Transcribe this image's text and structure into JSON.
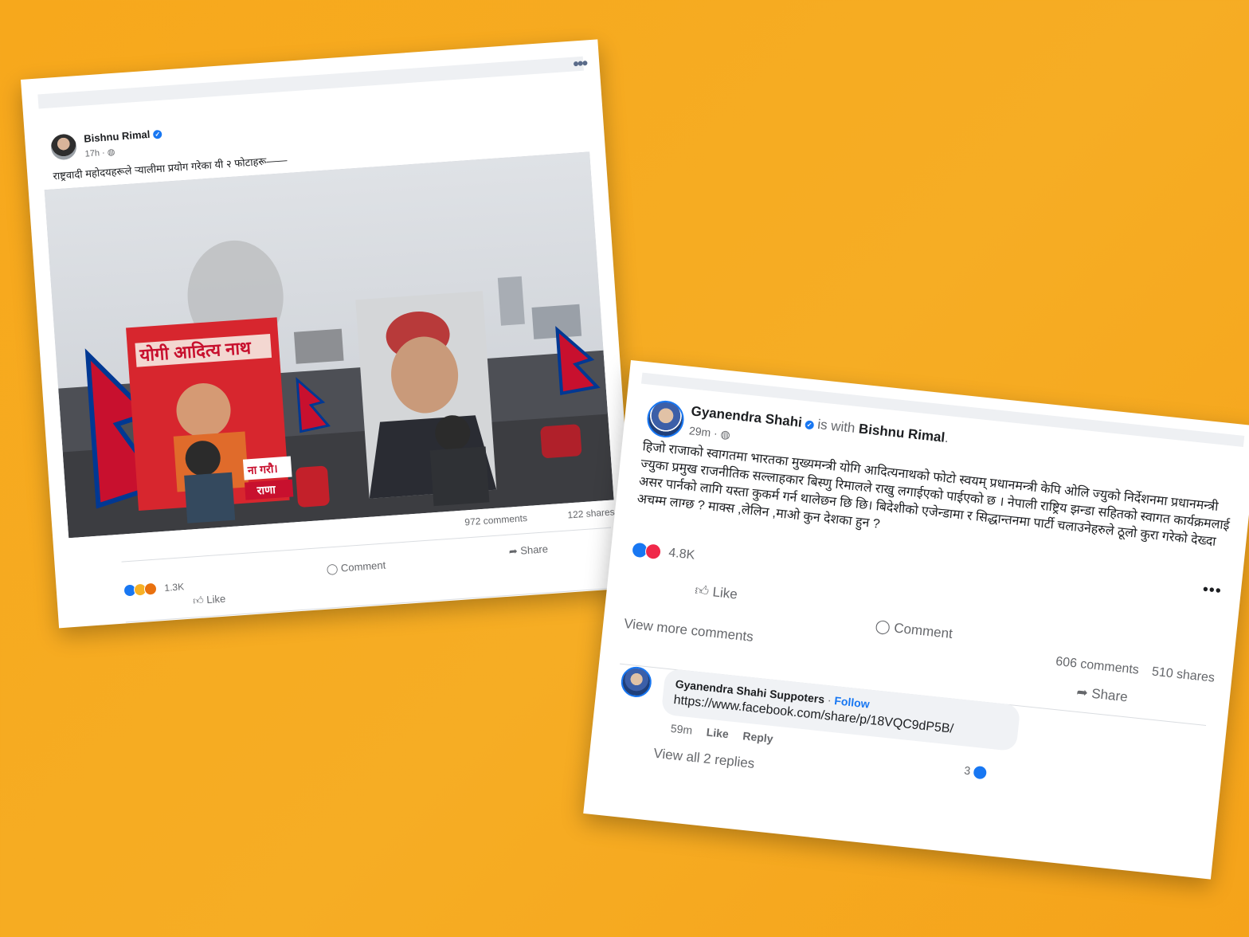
{
  "colors": {
    "background": "#f6a81f",
    "brand_blue": "#1877f2"
  },
  "post1": {
    "author": "Bishnu Rimal",
    "time": "17h ·",
    "caption": "राष्ट्रवादी महोदयहरूले र्‍यालीमा प्रयोग गरेका यी २ फोटाहरू——",
    "photo": {
      "banner_left": "योगी आदित्य नाथ",
      "banner_bottom_1": "ना गरौ।",
      "banner_bottom_2": "राणा"
    },
    "comments": "972 comments",
    "shares": "122 shares",
    "reactions": "1.3K",
    "actions": {
      "like": "Like",
      "comment": "Comment",
      "share": "Share"
    }
  },
  "post2": {
    "author": "Gyanendra Shahi",
    "with_text": "is with",
    "with_name": "Bishnu Rimal",
    "with_end": ".",
    "time": "29m ·",
    "body": "हिजो राजाको स्वागतमा भारतका मुख्यमन्त्री योगि आदित्यनाथको फोटो  स्वयम् प्रधानमन्त्री केपि ओलि ज्युको निर्देशनमा प्रधानमन्त्री ज्युका प्रमुख राजनीतिक सल्लाहकार बिस्णु रिमालले राखु लगाईएको पाईएको छ । नेपाली राष्ट्रिय झन्डा सहितको स्वागत कार्यक्रमलाई असर पार्नको लागि यस्ता कुकर्म गर्न थालेछन छि छि। बिदेशीको एजेन्डामा र सिद्धान्तनमा  पार्टी चलाउनेहरुले ठूलो कुरा गरेको देख्दा अचम्म लाग्छ ?  माक्स ,लेलिन ,माओ कुन देशका हुन ?",
    "reactions": "4.8K",
    "comments": "606 comments",
    "shares": "510 shares",
    "actions": {
      "like": "Like",
      "comment": "Comment",
      "share": "Share"
    },
    "view_more": "View more comments",
    "comment": {
      "author": "Gyanendra Shahi Suppoters",
      "follow": "Follow",
      "dot": " · ",
      "text": "https://www.facebook.com/share/p/18VQC9dP5B/",
      "time": "59m",
      "like": "Like",
      "reply": "Reply",
      "like_count": "3",
      "view_replies": "View all 2 replies"
    }
  }
}
